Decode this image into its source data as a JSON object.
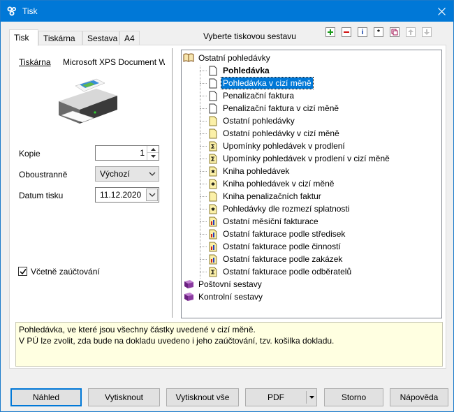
{
  "window": {
    "title": "Tisk"
  },
  "tabs": [
    {
      "label": "Tisk",
      "active": true
    },
    {
      "label": "Tiskárna",
      "active": false
    },
    {
      "label": "Sestava",
      "active": false
    },
    {
      "label": "A4",
      "active": false
    }
  ],
  "tree_header": "Vyberte tiskovou sestavu",
  "printer": {
    "label": "Tiskárna",
    "name": "Microsoft XPS Document W"
  },
  "copies": {
    "label": "Kopie",
    "value": "1"
  },
  "duplex": {
    "label": "Oboustranně",
    "value": "Výchozí"
  },
  "print_date": {
    "label": "Datum tisku",
    "value": "11.12.2020"
  },
  "include_accounting": {
    "label": "Včetně zaúčtování",
    "checked": true
  },
  "tree": {
    "root": "Ostatní pohledávky",
    "items": [
      {
        "label": "Pohledávka",
        "icon": "doc-icon",
        "bold": true
      },
      {
        "label": "Pohledávka v cizí měně",
        "icon": "doc-icon",
        "selected": true
      },
      {
        "label": "Penalizační faktura",
        "icon": "doc-icon"
      },
      {
        "label": "Penalizační faktura v cizí měně",
        "icon": "doc-icon"
      },
      {
        "label": "Ostatní pohledávky",
        "icon": "yellow-doc-icon"
      },
      {
        "label": "Ostatní pohledávky v cizí měně",
        "icon": "yellow-doc-icon"
      },
      {
        "label": "Upomínky pohledávek v prodlení",
        "icon": "sum-doc-icon"
      },
      {
        "label": "Upomínky pohledávek v prodlení v cizí měně",
        "icon": "sum-doc-icon"
      },
      {
        "label": "Kniha pohledávek",
        "icon": "star-doc-icon"
      },
      {
        "label": "Kniha pohledávek v cizí měně",
        "icon": "star-doc-icon"
      },
      {
        "label": "Kniha penalizačních faktur",
        "icon": "yellow-doc-icon"
      },
      {
        "label": "Pohledávky dle rozmezí splatnosti",
        "icon": "star-doc-icon"
      },
      {
        "label": "Ostatní měsíční fakturace",
        "icon": "chart-doc-icon"
      },
      {
        "label": "Ostatní fakturace podle středisek",
        "icon": "chart-doc-icon"
      },
      {
        "label": "Ostatní fakturace podle činností",
        "icon": "chart-doc-icon"
      },
      {
        "label": "Ostatní fakturace podle zakázek",
        "icon": "chart-doc-icon"
      },
      {
        "label": "Ostatní fakturace podle odběratelů",
        "icon": "sum-doc-icon"
      }
    ],
    "groups": [
      {
        "label": "Poštovní sestavy",
        "icon": "closed-book-icon"
      },
      {
        "label": "Kontrolní sestavy",
        "icon": "closed-book-icon"
      }
    ]
  },
  "description": {
    "line1": "Pohledávka, ve které jsou všechny částky uvedené v cizí měně.",
    "line2": "V PÚ lze zvolit, zda bude na dokladu uvedeno i jeho zaúčtování, tzv. košilka dokladu."
  },
  "buttons": {
    "preview": "Náhled",
    "print": "Vytisknout",
    "print_all": "Vytisknout vše",
    "pdf": "PDF",
    "cancel": "Storno",
    "help": "Nápověda"
  },
  "toolbar": {
    "icons": [
      "add-icon",
      "remove-icon",
      "info-icon",
      "asterisk-icon",
      "copy-icon",
      "move-up-icon",
      "move-down-icon"
    ],
    "info_glyph": "i",
    "asterisk_glyph": "*"
  },
  "colors": {
    "accent": "#0078d7",
    "description_bg": "#ffffe1"
  }
}
